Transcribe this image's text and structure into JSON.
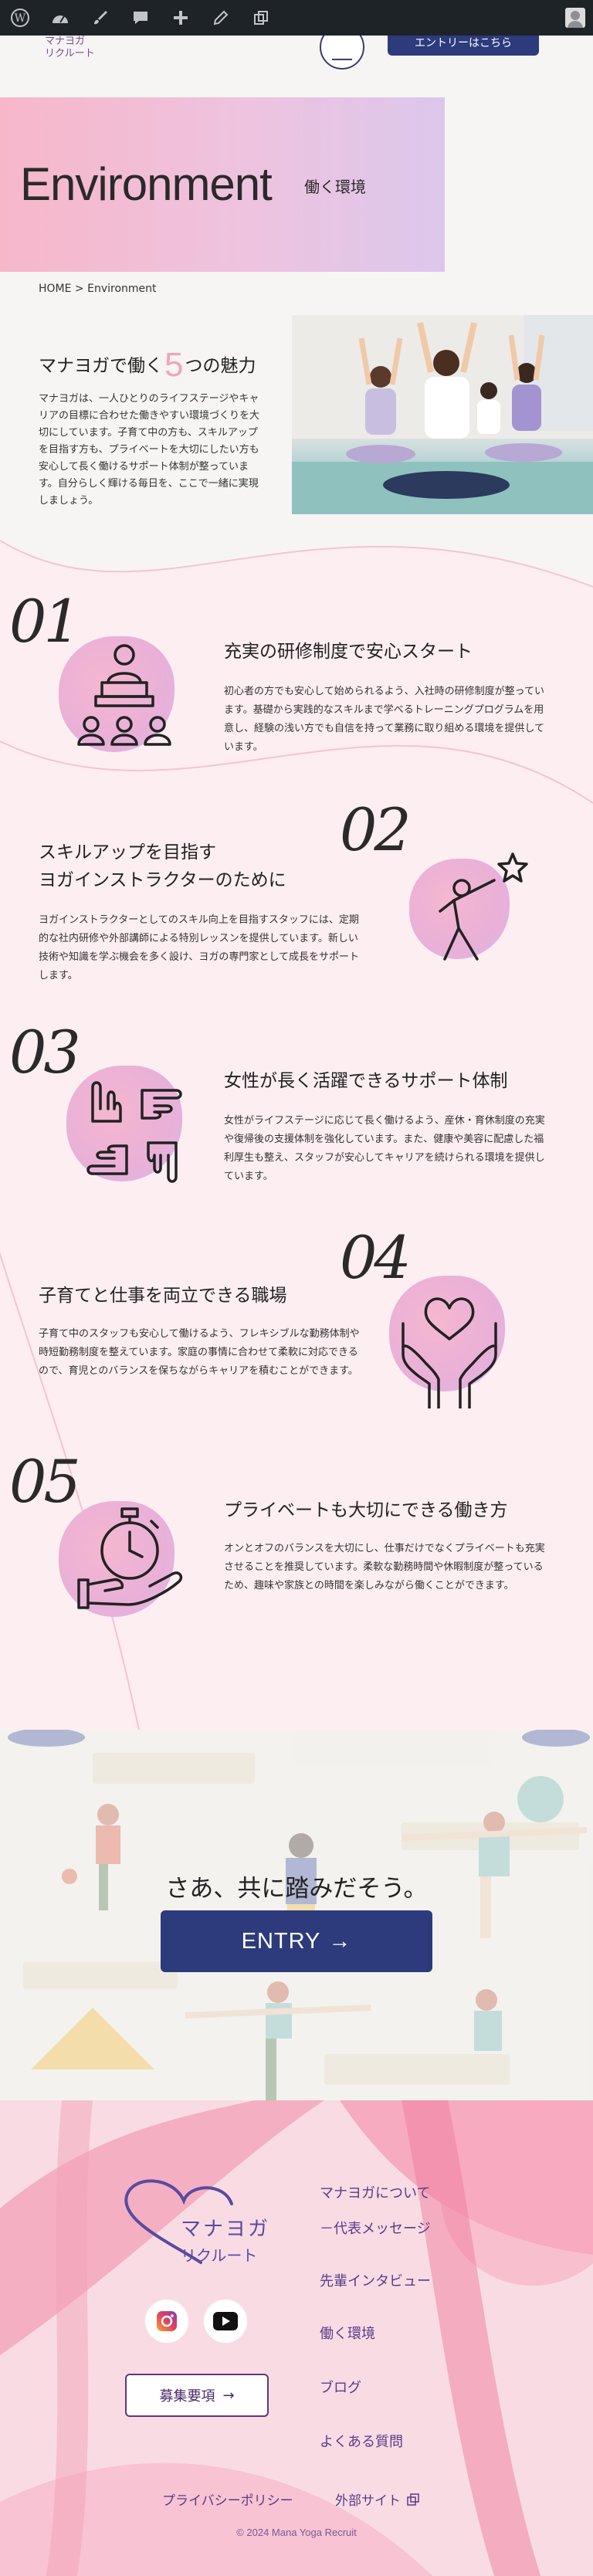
{
  "header": {
    "logo_line1": "マナヨガ",
    "logo_line2": "リクルート",
    "cta_label": "エントリーはこちら"
  },
  "hero": {
    "title": "Environment",
    "subtitle": "働く環境"
  },
  "breadcrumb": "HOME > Environment",
  "intro": {
    "title_pre": "マナヨガで働く",
    "title_num": "5",
    "title_post": "つの魅力",
    "text": "マナヨガは、一人ひとりのライフステージやキャリアの目標に合わせた働きやすい環境づくりを大切にしています。子育て中の方も、スキルアップを目指す方も、プライベートを大切にしたい方も安心して長く働けるサポート体制が整っています。自分らしく輝ける毎日を、ここで一緒に実現しましょう。"
  },
  "features": [
    {
      "num": "01",
      "title": "充実の研修制度で安心スタート",
      "text": "初心者の方でも安心して始められるよう、入社時の研修制度が整っています。基礎から実践的なスキルまで学べるトレーニングプログラムを用意し、経験の浅い方でも自信を持って業務に取り組める環境を提供しています。"
    },
    {
      "num": "02",
      "title": "スキルアップを目指す\nヨガインストラクターのために",
      "text": "ヨガインストラクターとしてのスキル向上を目指すスタッフには、定期的な社内研修や外部講師による特別レッスンを提供しています。新しい技術や知識を学ぶ機会を多く設け、ヨガの専門家として成長をサポートします。"
    },
    {
      "num": "03",
      "title": "女性が長く活躍できるサポート体制",
      "text": "女性がライフステージに応じて長く働けるよう、産休・育休制度の充実や復帰後の支援体制を強化しています。また、健康や美容に配慮した福利厚生も整え、スタッフが安心してキャリアを続けられる環境を提供しています。"
    },
    {
      "num": "04",
      "title": "子育てと仕事を両立できる職場",
      "text": "子育て中のスタッフも安心して働けるよう、フレキシブルな勤務体制や時短勤務制度を整えています。家庭の事情に合わせて柔軟に対応できるので、育児とのバランスを保ちながらキャリアを積むことができます。"
    },
    {
      "num": "05",
      "title": "プライベートも大切にできる働き方",
      "text": "オンとオフのバランスを大切にし、仕事だけでなくプライベートも充実させることを推奨しています。柔軟な勤務時間や休暇制度が整っているため、趣味や家族との時間を楽しみながら働くことができます。"
    }
  ],
  "entry": {
    "question": "さあ、共に踏みだそう。",
    "button_label": "ENTRY",
    "button_arrow": "→"
  },
  "footer": {
    "logo_line1": "マナヨガ",
    "logo_line2": "リクルート",
    "recruit_label": "募集要項",
    "recruit_arrow": "→",
    "links": [
      "マナヨガについて",
      "－代表メッセージ",
      "先輩インタビュー",
      "働く環境",
      "ブログ",
      "よくある質問"
    ],
    "privacy": "プライバシーポリシー",
    "external": "外部サイト",
    "copyright": "© 2024 Mana Yoga Recruit"
  },
  "colors": {
    "navy": "#2d3a7c",
    "pink": "#f0a4be",
    "purple": "#5a3a8a"
  }
}
